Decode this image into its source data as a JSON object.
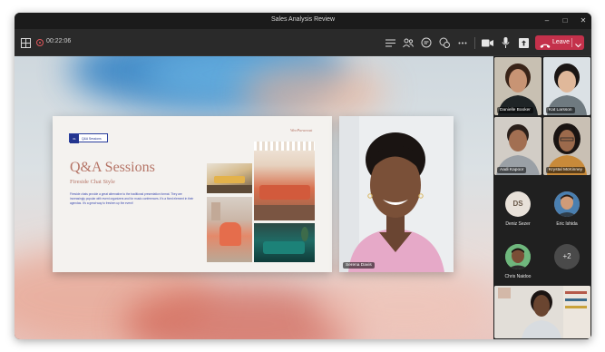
{
  "window": {
    "title": "Sales Analysis Review"
  },
  "toolbar": {
    "timer": "00:22:06",
    "leave_label": "Leave",
    "icons": [
      "layout-grid-icon",
      "record-icon",
      "chat-list-icon",
      "participants-icon",
      "chat-bubble-icon",
      "reactions-icon",
      "more-icon",
      "camera-icon",
      "microphone-icon",
      "share-icon",
      "phone-hangup-icon",
      "chevron-down-icon"
    ]
  },
  "slide": {
    "tag_number": "01",
    "tag_label": "Q&A Sessions",
    "title": "Q&A Sessions",
    "subtitle": "Fireside Chat Style",
    "body": "Fireside chats provide a great alternative to the traditional presentation format. They are increasingly popular with event organizers and for music conferences. It's a fixed element in their agendas. It's a great way to freshen up the event!",
    "brand": "WeeParanoat"
  },
  "presenter": {
    "name": "Serena Davis"
  },
  "roster": {
    "video_tiles": [
      {
        "name": "Danielle Booker"
      },
      {
        "name": "Kat Larsson"
      },
      {
        "name": "Aadi Kapoor"
      },
      {
        "name": "Krystal McKinney"
      }
    ],
    "avatars": [
      {
        "initials": "DS",
        "name": "Deniz Sezer"
      },
      {
        "name": "Eric Ishida"
      },
      {
        "name": "Chris Naidoo"
      },
      {
        "more": "+2"
      }
    ]
  },
  "colors": {
    "leave": "#c4314b",
    "slide_accent": "#b57466",
    "slide_blue": "#23358f"
  }
}
